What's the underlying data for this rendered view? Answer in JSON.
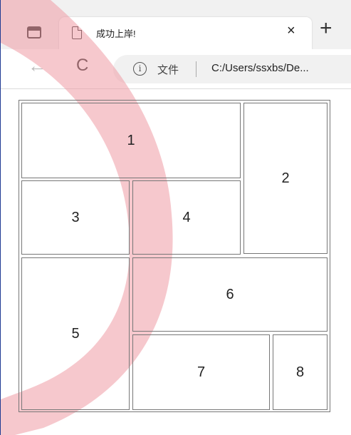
{
  "browser": {
    "tab_title": "成功上岸!",
    "tab_close": "×",
    "new_tab": "+",
    "back": "←",
    "refresh": "C",
    "address_label": "文件",
    "address_url": "C:/Users/ssxbs/De..."
  },
  "table": {
    "cells": [
      "1",
      "2",
      "3",
      "4",
      "5",
      "6",
      "7",
      "8"
    ]
  },
  "colors": {
    "watermark": "#ef9aa4",
    "border": "#777777",
    "window_edge": "#1f3a93"
  }
}
